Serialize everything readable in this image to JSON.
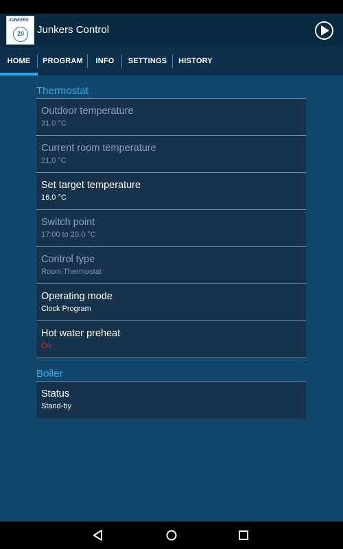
{
  "app": {
    "title": "Junkers Control",
    "logo_brand": "JUNKERS",
    "logo_badge": "20"
  },
  "tabs": [
    {
      "label": "HOME",
      "active": true
    },
    {
      "label": "PROGRAM",
      "active": false
    },
    {
      "label": "INFO",
      "active": false
    },
    {
      "label": "SETTINGS",
      "active": false
    },
    {
      "label": "HISTORY",
      "active": false
    }
  ],
  "sections": {
    "thermostat": {
      "title": "Thermostat",
      "items": [
        {
          "label": "Outdoor temperature",
          "value": "31.0 °C",
          "enabled": false
        },
        {
          "label": "Current room temperature",
          "value": "21.0 °C",
          "enabled": false
        },
        {
          "label": "Set target temperature",
          "value": "16.0 °C",
          "enabled": true
        },
        {
          "label": "Switch point",
          "value": "17:00 to 20.0 °C",
          "enabled": false
        },
        {
          "label": "Control type",
          "value": "Room Thermostat",
          "enabled": false
        },
        {
          "label": "Operating mode",
          "value": "Clock Program",
          "enabled": true
        },
        {
          "label": "Hot water preheat",
          "value": "On",
          "enabled": true,
          "value_color": "#e8202a"
        }
      ]
    },
    "boiler": {
      "title": "Boiler",
      "items": [
        {
          "label": "Status",
          "value": "Stand-by",
          "enabled": true
        }
      ]
    }
  },
  "colors": {
    "accent": "#33a3e8",
    "background": "#12466b",
    "app_bar": "#0a2a42"
  },
  "icons": {
    "play": "play-circle-icon",
    "back": "back-icon",
    "home": "home-icon",
    "recents": "recents-icon"
  }
}
